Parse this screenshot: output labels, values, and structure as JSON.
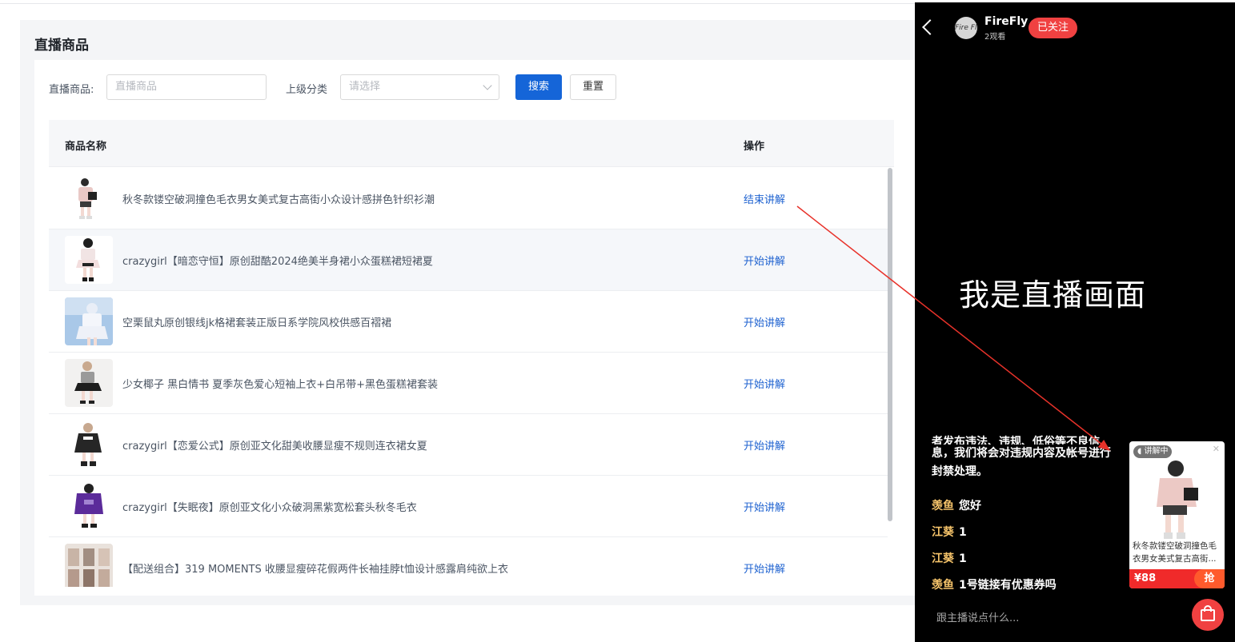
{
  "admin": {
    "title": "直播商品",
    "form": {
      "product_label": "直播商品:",
      "product_placeholder": "直播商品",
      "category_label": "上级分类",
      "category_placeholder": "请选择",
      "search_label": "搜索",
      "reset_label": "重置"
    },
    "table": {
      "col_name": "商品名称",
      "col_action": "操作",
      "rows": [
        {
          "name": "秋冬款镂空破洞撞色毛衣男女美式复古高街小众设计感拼色针织衫潮",
          "action": "结束讲解"
        },
        {
          "name": "crazygirl【暗恋守恒】原创甜酷2024绝美半身裙小众蛋糕裙短裙夏",
          "action": "开始讲解"
        },
        {
          "name": "空栗鼠丸原创银线jk格裙套装正版日系学院风校供感百褶裙",
          "action": "开始讲解"
        },
        {
          "name": "少女椰子 黑白情书 夏季灰色爱心短袖上衣+白吊带+黑色蛋糕裙套装",
          "action": "开始讲解"
        },
        {
          "name": "crazygirl【恋爱公式】原创亚文化甜美收腰显瘦不规则连衣裙女夏",
          "action": "开始讲解"
        },
        {
          "name": "crazygirl【失眠夜】原创亚文化小众破洞黑紫宽松套头秋冬毛衣",
          "action": "开始讲解"
        },
        {
          "name": "【配送组合】319 MOMENTS 收腰显瘦碎花假两件长袖挂脖t恤设计感露肩纯欲上衣",
          "action": "开始讲解"
        }
      ]
    }
  },
  "live": {
    "anchor_name": "FireFly",
    "avatar_text": "Fire Fly",
    "viewers": "2观看",
    "follow_label": "已关注",
    "stage_text": "我是直播画面",
    "notice_cut": "者发布违法、违规、低俗等不良信",
    "notice_text": "息，我们将会对违规内容及帐号进行封禁处理。",
    "comments": [
      {
        "user": "羡鱼",
        "text": "您好"
      },
      {
        "user": "江葵",
        "text": "1"
      },
      {
        "user": "江葵",
        "text": "1"
      },
      {
        "user": "羡鱼",
        "text": "1号链接有优惠券吗"
      }
    ],
    "input_placeholder": "跟主播说点什么...",
    "card": {
      "badge": "讲解中",
      "title": "秋冬款镂空破洞撞色毛衣男女美式复古高街...",
      "price": "¥88",
      "grab_label": "抢"
    }
  },
  "colors": {
    "primary": "#1565d8",
    "link": "#1e62d0",
    "live_red": "#f04141",
    "annotation_arrow": "#e8322a"
  }
}
